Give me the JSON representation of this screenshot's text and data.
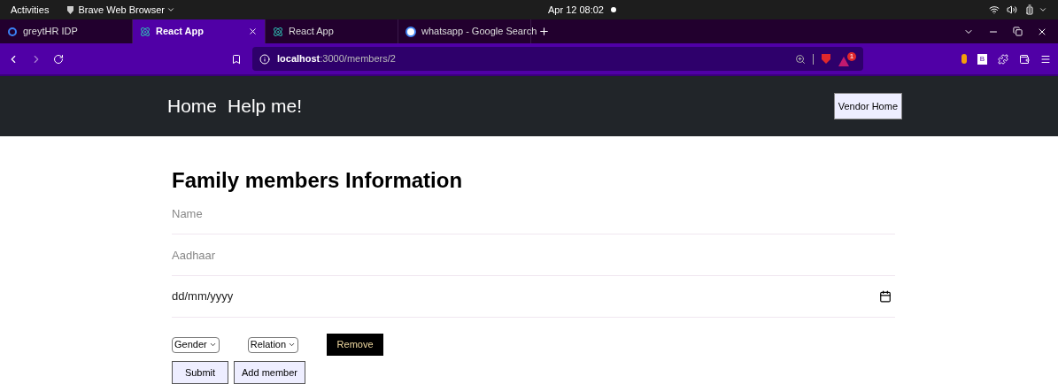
{
  "top_bar": {
    "activities": "Activities",
    "app_menu": "Brave Web Browser",
    "clock": "Apr 12  08:02"
  },
  "tabs": [
    {
      "label": "greytHR IDP",
      "selected": false,
      "kind": "greyt"
    },
    {
      "label": "React App",
      "selected": true,
      "kind": "react"
    },
    {
      "label": "React App",
      "selected": false,
      "kind": "react"
    },
    {
      "label": "whatsapp - Google Search",
      "selected": false,
      "kind": "google"
    }
  ],
  "address_bar": {
    "host": "localhost",
    "path": ":3000/members/2",
    "rewards_badge": "1",
    "extension_label": "B"
  },
  "navbar": {
    "links": [
      "Home",
      "Help me!"
    ],
    "vendor_button": "Vendor Home"
  },
  "form": {
    "title": "Family members Information",
    "fields": [
      {
        "kind": "text",
        "placeholder": "Name"
      },
      {
        "kind": "text",
        "placeholder": "Aadhaar"
      },
      {
        "kind": "date",
        "value": "dd/mm/yyyy"
      }
    ],
    "selects": [
      "Gender",
      "Relation"
    ],
    "remove_button": "Remove",
    "buttons": [
      "Submit",
      "Add member"
    ]
  }
}
